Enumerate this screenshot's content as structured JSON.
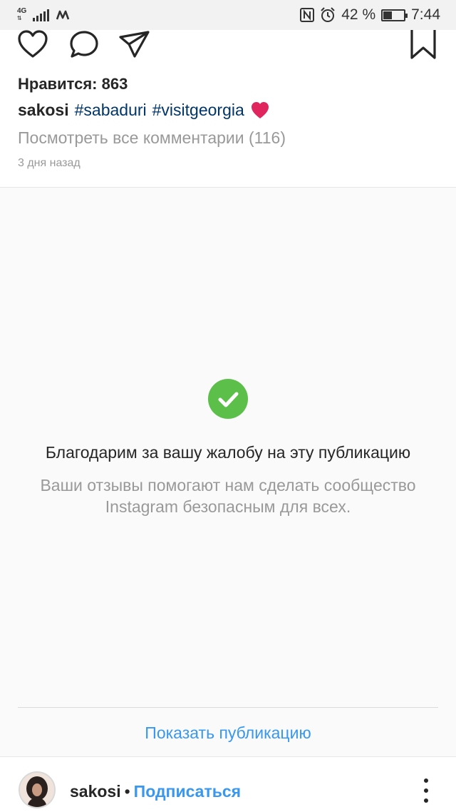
{
  "status_bar": {
    "network": "4G",
    "battery_percent": "42 %",
    "battery_level": 0.42,
    "time": "7:44"
  },
  "post": {
    "likes": "Нравится: 863",
    "caption": {
      "username": "sakosi",
      "hashtags": [
        "#sabaduri",
        "#visitgeorgia"
      ],
      "emoji": "heart"
    },
    "view_comments": "Посмотреть все комментарии (116)",
    "time_ago": "3 дня назад"
  },
  "report": {
    "title": "Благодарим за вашу жалобу на эту публикацию",
    "subtitle": "Ваши отзывы помогают нам сделать сообщество Instagram безопасным для всех.",
    "show_post": "Показать публикацию",
    "accent_color": "#5bbf4a"
  },
  "author": {
    "username": "sakosi",
    "separator": "•",
    "follow": "Подписаться"
  },
  "colors": {
    "link": "#3897f0",
    "hashtag": "#003569",
    "muted": "#999999",
    "heart": "#e0245e"
  },
  "icons": [
    "signal-icon",
    "carrier-icon",
    "nfc-icon",
    "alarm-icon",
    "battery-icon",
    "heart-icon",
    "comment-icon",
    "share-icon",
    "bookmark-icon",
    "check-icon",
    "more-icon"
  ]
}
